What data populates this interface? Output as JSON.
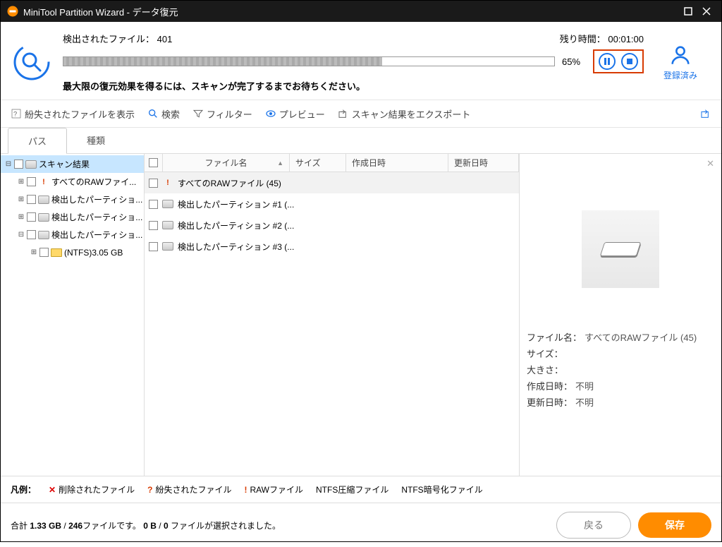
{
  "title": "MiniTool Partition Wizard - データ復元",
  "scan": {
    "filecount_label": "検出されたファイル：",
    "filecount": "401",
    "remaining_label": "残り時間：",
    "remaining": "00:01:00",
    "percent": "65%",
    "message": "最大限の復元効果を得るには、スキャンが完了するまでお待ちください。"
  },
  "account_label": "登録済み",
  "toolbar": {
    "lost": "紛失されたファイルを表示",
    "search": "検索",
    "filter": "フィルター",
    "preview": "プレビュー",
    "export": "スキャン結果をエクスポート"
  },
  "tabs": {
    "path": "パス",
    "type": "種類"
  },
  "tree": [
    {
      "label": "スキャン結果",
      "sel": true,
      "indent": 0,
      "icon": "drive",
      "exp": "⊟"
    },
    {
      "label": "すべてのRAWファイ...",
      "indent": 1,
      "icon": "raw",
      "exp": "⊞"
    },
    {
      "label": "検出したパーティショ...",
      "indent": 1,
      "icon": "drive",
      "exp": "⊞"
    },
    {
      "label": "検出したパーティショ...",
      "indent": 1,
      "icon": "drive",
      "exp": "⊞"
    },
    {
      "label": "検出したパーティショ...",
      "indent": 1,
      "icon": "drive",
      "exp": "⊟"
    },
    {
      "label": "(NTFS)3.05 GB",
      "indent": 2,
      "icon": "folder",
      "exp": "⊞"
    }
  ],
  "columns": {
    "name": "ファイル名",
    "size": "サイズ",
    "cdate": "作成日時",
    "mdate": "更新日時"
  },
  "files": [
    {
      "label": "すべてのRAWファイル (45)",
      "icon": "raw",
      "sel": true
    },
    {
      "label": "検出したパーティション #1 (...",
      "icon": "drive"
    },
    {
      "label": "検出したパーティション #2 (...",
      "icon": "drive"
    },
    {
      "label": "検出したパーティション #3 (...",
      "icon": "drive"
    }
  ],
  "preview": {
    "name_label": "ファイル名：",
    "name": "すべてのRAWファイル (45)",
    "size_label": "サイズ：",
    "size": "",
    "bigness_label": "大きさ：",
    "bigness": "",
    "cdate_label": "作成日時：",
    "cdate": "不明",
    "mdate_label": "更新日時：",
    "mdate": "不明"
  },
  "legend": {
    "title": "凡例：",
    "deleted": "削除されたファイル",
    "lost": "紛失されたファイル",
    "raw": "RAWファイル",
    "compressed": "NTFS圧縮ファイル",
    "encrypted": "NTFS暗号化ファイル"
  },
  "footer": {
    "total_prefix": "合計 ",
    "total_size": "1.33 GB",
    "total_sep": " / ",
    "total_files": "246",
    "total_suffix": "ファイルです。",
    "sel_size": "0 B",
    "sel_sep": " / ",
    "sel_files": "0 ",
    "sel_suffix": "ファイルが選択されました。",
    "back": "戻る",
    "save": "保存"
  }
}
